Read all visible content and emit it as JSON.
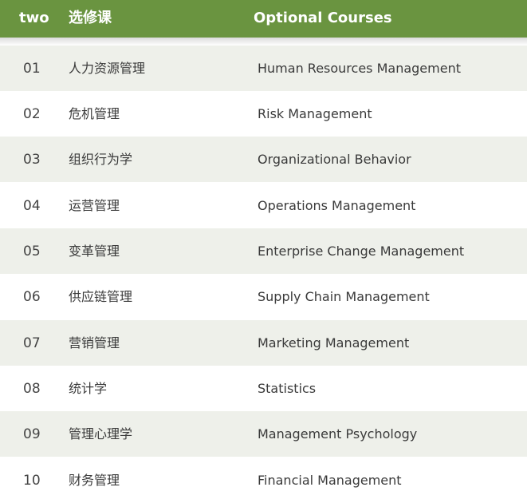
{
  "header": {
    "number": "two",
    "chinese": "选修课",
    "english": "Optional Courses"
  },
  "colors": {
    "header_bg": "#6a9440",
    "row_alt_bg": "#eef0ea",
    "text": "#3a3a3a"
  },
  "rows": [
    {
      "num": "01",
      "cn": "人力资源管理",
      "en": "Human Resources Management"
    },
    {
      "num": "02",
      "cn": "危机管理",
      "en": "Risk Management"
    },
    {
      "num": "03",
      "cn": "组织行为学",
      "en": "Organizational Behavior"
    },
    {
      "num": "04",
      "cn": "运营管理",
      "en": "Operations Management"
    },
    {
      "num": "05",
      "cn": "变革管理",
      "en": "Enterprise Change Management"
    },
    {
      "num": "06",
      "cn": "供应链管理",
      "en": "Supply Chain Management"
    },
    {
      "num": "07",
      "cn": "营销管理",
      "en": "Marketing Management"
    },
    {
      "num": "08",
      "cn": "统计学",
      "en": "Statistics"
    },
    {
      "num": "09",
      "cn": "管理心理学",
      "en": "Management Psychology"
    },
    {
      "num": "10",
      "cn": "财务管理",
      "en": "Financial Management"
    }
  ]
}
